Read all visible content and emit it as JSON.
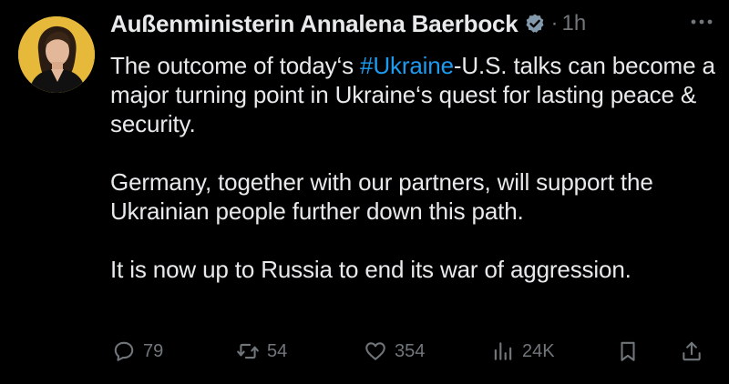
{
  "post": {
    "author": {
      "display_name": "Außenministerin Annalena Baerbock",
      "verified_icon": "verified-badge-icon",
      "verified_color": "#829aab"
    },
    "separator": "·",
    "timestamp": "1h",
    "more_icon": "more-horizontal-icon",
    "text": {
      "p1_before": "The outcome of today‘s ",
      "p1_hashtag": "#Ukraine",
      "p1_after": "-U.S. talks can become a major turning point in Ukraine‘s quest for lasting peace & security.",
      "p2": "Germany, together with our partners, will support the Ukrainian people further down this path.",
      "p3": "It is now up to Russia to end its war of aggression."
    },
    "actions": {
      "reply": {
        "icon": "reply-icon",
        "count": "79"
      },
      "repost": {
        "icon": "repost-icon",
        "count": "54"
      },
      "like": {
        "icon": "heart-icon",
        "count": "354"
      },
      "views": {
        "icon": "views-chart-icon",
        "count": "24K"
      },
      "bookmark": {
        "icon": "bookmark-icon"
      },
      "share": {
        "icon": "share-icon"
      }
    },
    "colors": {
      "background": "#000000",
      "text": "#e7e9ea",
      "muted": "#71767b",
      "link": "#1d9bf0",
      "avatar_bg": "#e7b93a"
    }
  }
}
